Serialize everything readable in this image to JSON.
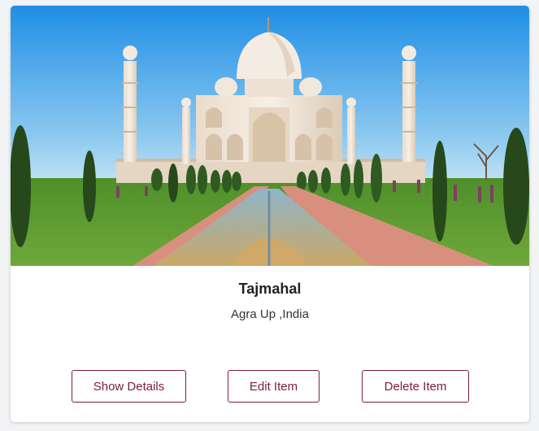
{
  "card": {
    "title": "Tajmahal",
    "subtitle": "Agra Up ,India",
    "image_alt": "Taj Mahal"
  },
  "actions": {
    "show_details": "Show Details",
    "edit_item": "Edit Item",
    "delete_item": "Delete Item"
  },
  "colors": {
    "button_accent": "#7a1f3d",
    "sky": "#1f8ee6"
  }
}
